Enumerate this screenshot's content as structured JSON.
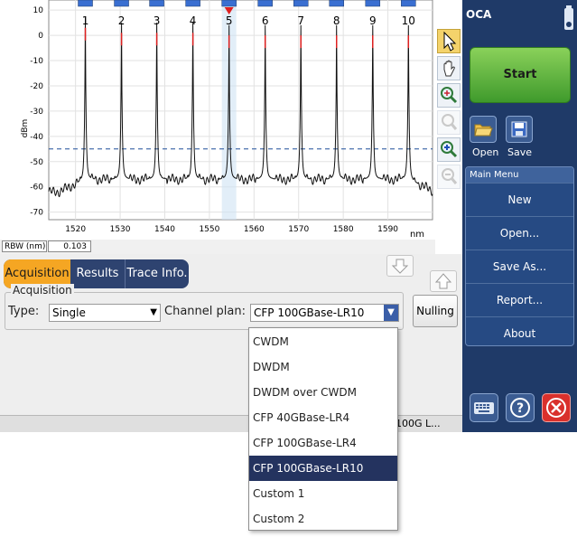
{
  "chart": {
    "y_label": "dBm",
    "x_unit": "nm",
    "y_ticks": [
      "10",
      "0",
      "-10",
      "-20",
      "-30",
      "-40",
      "-50",
      "-60",
      "-70"
    ],
    "x_ticks": [
      "1520",
      "1530",
      "1540",
      "1550",
      "1560",
      "1570",
      "1580",
      "1590"
    ],
    "channels": [
      "1",
      "2",
      "3",
      "4",
      "5",
      "6",
      "7",
      "8",
      "9",
      "10"
    ],
    "selected_channel": "5"
  },
  "chart_data": {
    "type": "line",
    "ylabel": "dBm",
    "xlabel": "nm",
    "xlim": [
      1514,
      1600
    ],
    "ylim": [
      -73,
      14
    ],
    "grid": true,
    "threshold_dbm": -45,
    "peaks_nm": [
      1522.2,
      1530.3,
      1538.2,
      1546.3,
      1554.4,
      1562.5,
      1570.5,
      1578.5,
      1586.6,
      1594.6
    ],
    "peak_dbm": [
      3,
      1,
      1,
      1,
      0,
      0,
      0,
      0,
      0,
      0
    ],
    "noise_floor_dbm": -57,
    "trace_edge_dbm": -62
  },
  "rbw": {
    "label": "RBW (nm)",
    "value": "0.103"
  },
  "tabs": [
    {
      "label": "Acquisition",
      "active": true
    },
    {
      "label": "Results",
      "active": false
    },
    {
      "label": "Trace Info.",
      "active": false
    }
  ],
  "acquisition": {
    "group_label": "Acquisition",
    "type_label": "Type:",
    "type_value": "Single",
    "plan_label": "Channel plan:",
    "plan_value": "CFP 100GBase-LR10"
  },
  "nulling_label": "Nulling",
  "status_text": "100G L...",
  "dropdown_options": [
    "CWDM",
    "DWDM",
    "DWDM over CWDM",
    "CFP 40GBase-LR4",
    "CFP 100GBase-LR4",
    "CFP 100GBase-LR10",
    "Custom 1",
    "Custom 2"
  ],
  "dropdown_selected": "CFP 100GBase-LR10",
  "sidebar": {
    "title": "OCA",
    "start_label": "Start",
    "open_label": "Open",
    "save_label": "Save",
    "menu_header": "Main Menu",
    "menu_items": [
      "New",
      "Open...",
      "Save As...",
      "Report...",
      "About"
    ]
  },
  "colors": {
    "sidebar_bg": "#1f3a68",
    "tab_active": "#f5a623",
    "start_green": "#4caf35",
    "close_red": "#d9302c",
    "selection_blue": "#24335f"
  },
  "icons": [
    "arrow-cursor-icon",
    "hand-pan-icon",
    "zoom-fit-icon",
    "zoom-1-1-icon",
    "zoom-in-icon",
    "zoom-out-icon",
    "arrow-down-icon",
    "arrow-up-icon",
    "open-folder-icon",
    "save-disk-icon",
    "keyboard-icon",
    "help-icon",
    "close-icon",
    "battery-icon"
  ]
}
